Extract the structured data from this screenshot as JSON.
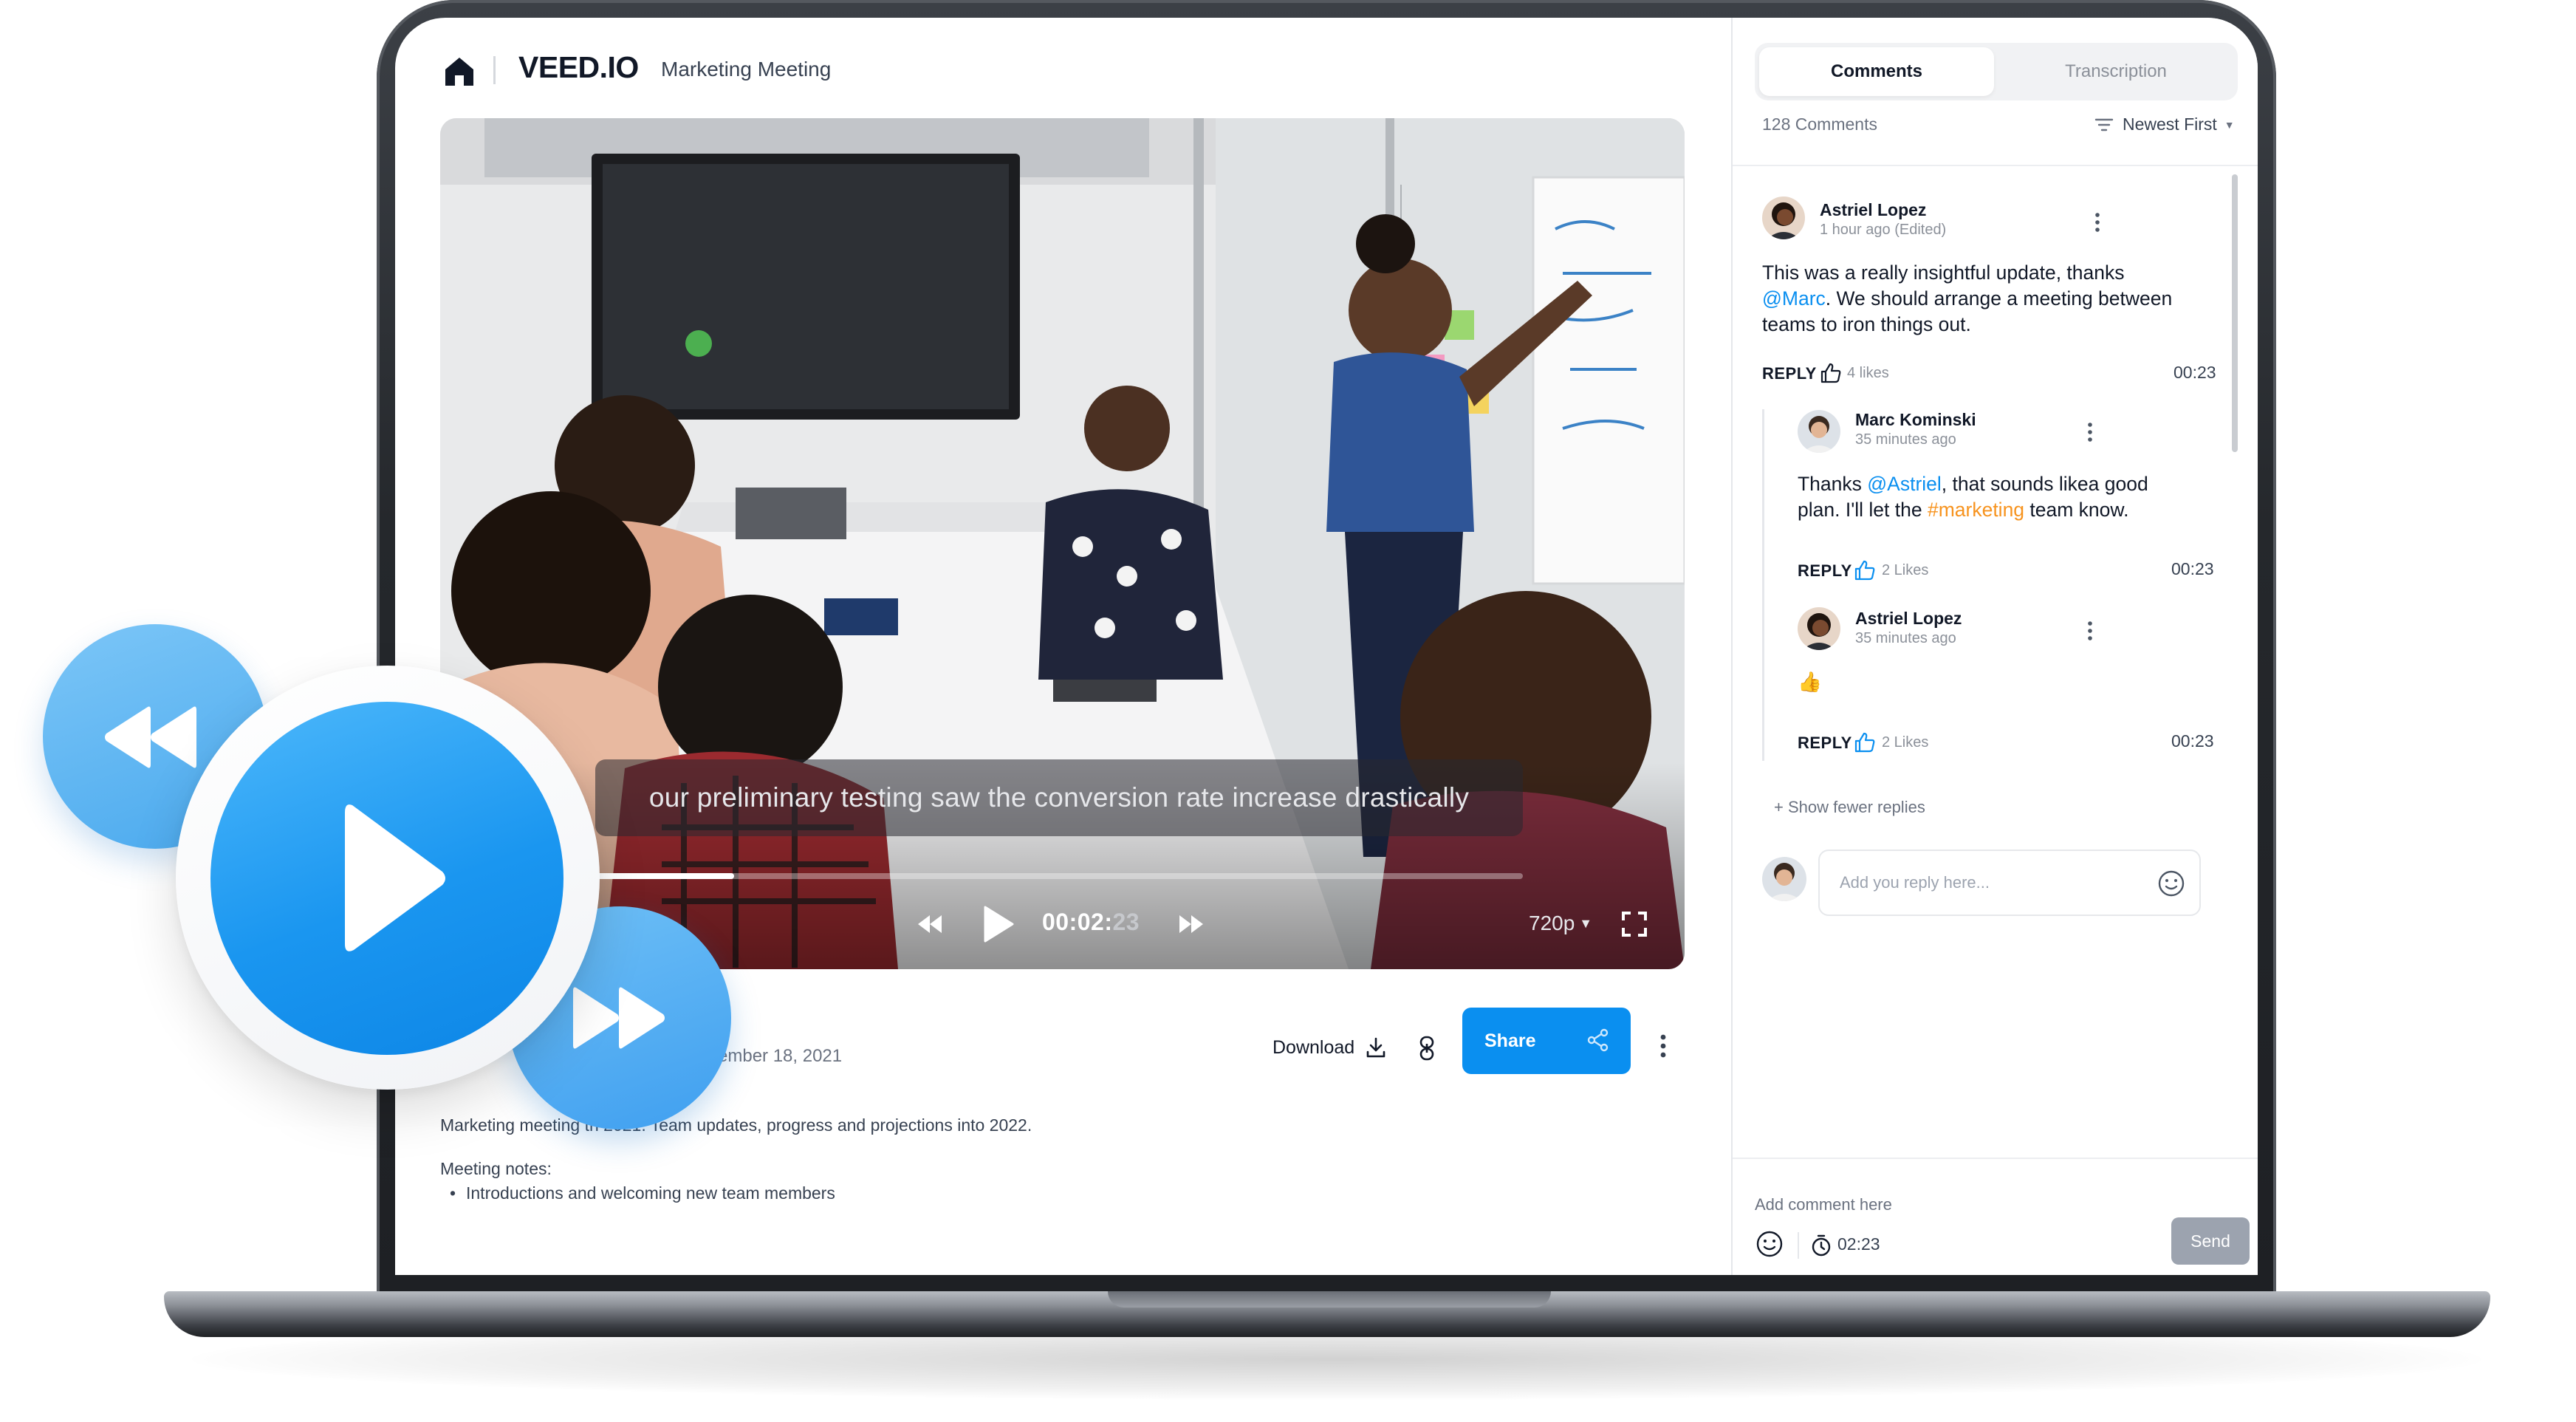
{
  "app": {
    "brand": "VEED.IO",
    "project_title": "Marketing Meeting"
  },
  "player": {
    "caption": "our preliminary testing saw the conversion rate increase drastically",
    "time_main": "00:02:",
    "time_dim": "23",
    "quality": "720p",
    "progress": 0.15
  },
  "video_meta": {
    "date_fragment": "ember 18, 2021",
    "download_label": "Download",
    "share_label": "Share",
    "description": "Marketing meeting         th 2021. Team updates, progress and projections into 2022.",
    "notes_title": "Meeting notes:",
    "notes_items": [
      "Introductions and welcoming new team members"
    ]
  },
  "comments_panel": {
    "tabs": [
      "Comments",
      "Transcription"
    ],
    "active_tab": "Comments",
    "count_label": "128 Comments",
    "sort_label": "Newest First",
    "comments": [
      {
        "author": "Astriel Lopez",
        "meta": "1 hour ago  (Edited)",
        "text_parts": [
          "This was a really insightful update, thanks",
          "@Marc",
          ". We should arrange a meeting between",
          "teams to iron things out."
        ],
        "reply_label": "REPLY",
        "likes": "4 likes",
        "time": "00:23"
      },
      {
        "author": "Marc Kominski",
        "meta": "35 minutes ago",
        "text_parts": [
          "Thanks ",
          "@Astriel",
          ", that sounds likea good",
          "plan. I'll let the ",
          "#marketing",
          " team know."
        ],
        "reply_label": "REPLY",
        "likes": "2 Likes",
        "time": "00:23"
      },
      {
        "author": "Astriel Lopez",
        "meta": "35 minutes ago",
        "text_parts": [
          "👍"
        ],
        "reply_label": "REPLY",
        "likes": "2 Likes",
        "time": "00:23"
      }
    ],
    "show_fewer_label": "+ Show fewer replies",
    "reply_placeholder": "Add you reply here...",
    "add_comment_label": "Add comment here",
    "comment_time": "02:23",
    "send_label": "Send"
  },
  "colors": {
    "accent": "#0a8ff0",
    "mention": "#0a8ff0",
    "hashtag": "#f7931e",
    "send_disabled": "#9ca3af"
  },
  "icons": [
    "home-icon",
    "rewind-icon",
    "play-icon",
    "fast-forward-icon",
    "fullscreen-icon",
    "download-icon",
    "link-icon",
    "share-icon",
    "more-icon",
    "filter-icon",
    "thumbs-up-icon",
    "smile-icon",
    "clock-icon"
  ]
}
